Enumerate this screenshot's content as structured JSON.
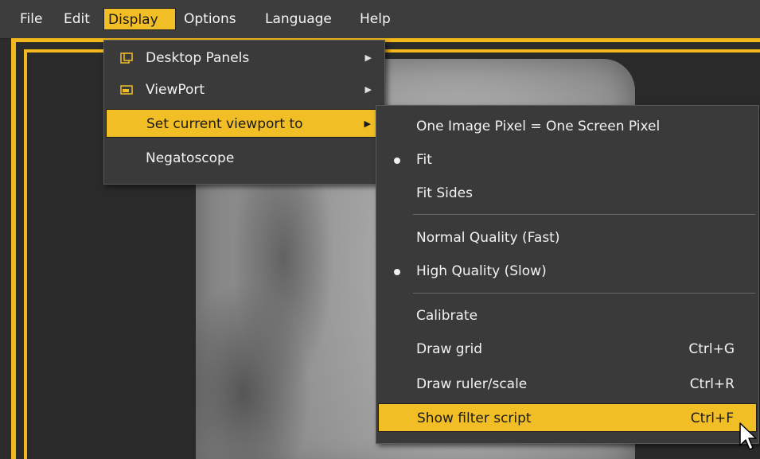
{
  "menubar": {
    "items": [
      "File",
      "Edit",
      "Display",
      "Options",
      "Language",
      "Help"
    ],
    "active_index": 2
  },
  "display_menu": {
    "items": [
      {
        "label": "Desktop Panels",
        "icon": "panels-icon",
        "has_submenu": true
      },
      {
        "label": "ViewPort",
        "icon": "viewport-icon",
        "has_submenu": true
      },
      {
        "label": "Set current viewport to",
        "icon": "",
        "has_submenu": true,
        "highlighted": true
      },
      {
        "label": "Negatoscope",
        "icon": "",
        "has_submenu": false
      }
    ]
  },
  "viewport_submenu": {
    "items": [
      {
        "label": "One Image Pixel = One Screen Pixel",
        "checked": false,
        "shortcut": ""
      },
      {
        "label": "Fit",
        "checked": true,
        "shortcut": ""
      },
      {
        "label": "Fit Sides",
        "checked": false,
        "shortcut": ""
      },
      {
        "label": "Normal Quality (Fast)",
        "checked": false,
        "shortcut": ""
      },
      {
        "label": "High Quality (Slow)",
        "checked": true,
        "shortcut": ""
      },
      {
        "label": "Calibrate",
        "checked": false,
        "shortcut": ""
      },
      {
        "label": "Draw grid",
        "checked": false,
        "shortcut": "Ctrl+G"
      },
      {
        "label": "Draw ruler/scale",
        "checked": false,
        "shortcut": "Ctrl+R"
      },
      {
        "label": "Show filter script",
        "checked": false,
        "shortcut": "Ctrl+F",
        "highlighted": true
      }
    ]
  },
  "colors": {
    "accent": "#f2be25",
    "menu_bg": "#3a3a3a",
    "background": "#2b2b2b"
  }
}
